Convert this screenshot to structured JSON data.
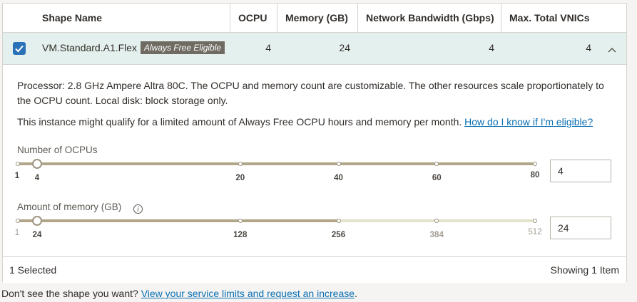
{
  "table": {
    "columns": [
      "Shape Name",
      "OCPU",
      "Memory (GB)",
      "Network Bandwidth (Gbps)",
      "Max. Total VNICs"
    ],
    "row": {
      "selected": true,
      "shape_name": "VM.Standard.A1.Flex",
      "badge": "Always Free Eligible",
      "ocpu": "4",
      "memory": "24",
      "bandwidth": "4",
      "vnics": "4"
    }
  },
  "detail": {
    "processor_text_line1": "Processor: 2.8 GHz Ampere Altra 80C. The OCPU and memory count are customizable. The other resources scale proportionately to",
    "processor_text_line2": "the OCPU count. Local disk: block storage only.",
    "free_text": "This instance might qualify for a limited amount of Always Free OCPU hours and memory per month.",
    "free_link": "How do I know if I'm eligible?",
    "ocpu_slider": {
      "label": "Number of OCPUs",
      "min": 1,
      "max": 80,
      "value": 4,
      "allowed_max": 80,
      "min_label": "1",
      "ticks": [
        "4",
        "20",
        "40",
        "60",
        "80"
      ],
      "input_value": "4"
    },
    "memory_slider": {
      "label": "Amount of memory (GB)",
      "info_icon": "info-icon",
      "min": 1,
      "max": 512,
      "value": 24,
      "allowed_max": 256,
      "min_label": "1",
      "ticks": [
        "24",
        "128",
        "256",
        "384",
        "512"
      ],
      "input_value": "24"
    }
  },
  "footer": {
    "selected_text": "1 Selected",
    "showing_text": "Showing 1 Item"
  },
  "bottom": {
    "text": "Don't see the shape you want?",
    "link": "View your service limits and request an increase",
    "period": "."
  },
  "colors": {
    "accent": "#2a72b8",
    "selected_row": "#e4f0ed",
    "slider_active": "#b0a688",
    "slider_inactive": "#e3e3cc",
    "badge_bg": "#6f6a62",
    "link": "#0a6fb3"
  }
}
